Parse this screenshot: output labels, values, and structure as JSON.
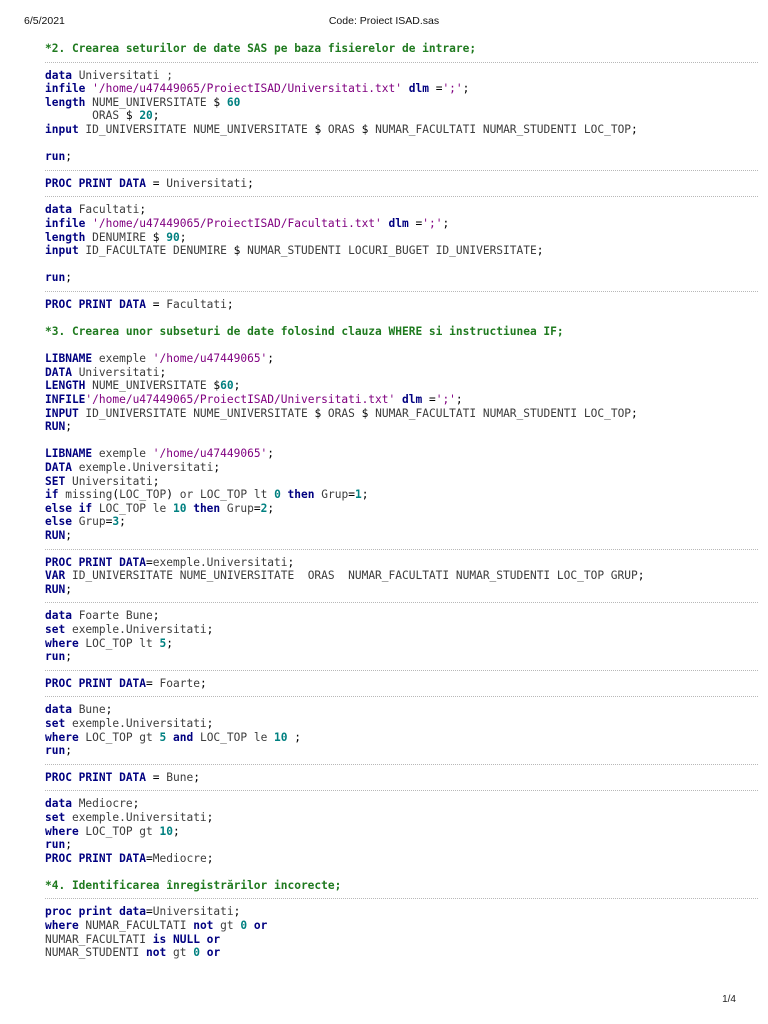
{
  "header": {
    "date": "6/5/2021",
    "title": "Code: Proiect ISAD.sas"
  },
  "footer": {
    "page": "1/4"
  },
  "code": [
    [
      [
        "cm",
        "*2. Crearea seturilor de date SAS pe baza fisierelor de intrare;"
      ]
    ],
    "sep",
    [
      [
        "kw",
        "data "
      ],
      [
        "tx",
        "Universitati ;"
      ]
    ],
    [
      [
        "kw",
        "infile "
      ],
      [
        "st",
        "'/home/u47449065/ProiectISAD/Universitati.txt'"
      ],
      [
        "kw",
        " dlm "
      ],
      [
        "pn",
        "="
      ],
      [
        "st",
        "';'"
      ],
      [
        "pn",
        ";"
      ]
    ],
    [
      [
        "kw",
        "length "
      ],
      [
        "tx",
        "NUME_UNIVERSITATE "
      ],
      [
        "pn",
        "$ "
      ],
      [
        "nm",
        "60"
      ]
    ],
    [
      [
        "tx",
        "       ORAS "
      ],
      [
        "pn",
        "$ "
      ],
      [
        "nm",
        "20"
      ],
      [
        "pn",
        ";"
      ]
    ],
    [
      [
        "kw",
        "input "
      ],
      [
        "tx",
        "ID_UNIVERSITATE NUME_UNIVERSITATE "
      ],
      [
        "pn",
        "$ "
      ],
      [
        "tx",
        "ORAS "
      ],
      [
        "pn",
        "$ "
      ],
      [
        "tx",
        "NUMAR_FACULTATI NUMAR_STUDENTI LOC_TOP"
      ],
      [
        "pn",
        ";"
      ]
    ],
    "gap",
    [
      [
        "kw",
        "run"
      ],
      [
        "pn",
        ";"
      ]
    ],
    "sep",
    [
      [
        "kw",
        "PROC PRINT DATA "
      ],
      [
        "pn",
        "= "
      ],
      [
        "tx",
        "Universitati"
      ],
      [
        "pn",
        ";"
      ]
    ],
    "sep",
    [
      [
        "kw",
        "data "
      ],
      [
        "tx",
        "Facultati"
      ],
      [
        "pn",
        ";"
      ]
    ],
    [
      [
        "kw",
        "infile "
      ],
      [
        "st",
        "'/home/u47449065/ProiectISAD/Facultati.txt'"
      ],
      [
        "kw",
        " dlm "
      ],
      [
        "pn",
        "="
      ],
      [
        "st",
        "';'"
      ],
      [
        "pn",
        ";"
      ]
    ],
    [
      [
        "kw",
        "length "
      ],
      [
        "tx",
        "DENUMIRE "
      ],
      [
        "pn",
        "$ "
      ],
      [
        "nm",
        "90"
      ],
      [
        "pn",
        ";"
      ]
    ],
    [
      [
        "kw",
        "input "
      ],
      [
        "tx",
        "ID_FACULTATE DENUMIRE "
      ],
      [
        "pn",
        "$ "
      ],
      [
        "tx",
        "NUMAR_STUDENTI LOCURI_BUGET ID_UNIVERSITATE"
      ],
      [
        "pn",
        ";"
      ]
    ],
    "gap",
    [
      [
        "kw",
        "run"
      ],
      [
        "pn",
        ";"
      ]
    ],
    "sep",
    [
      [
        "kw",
        "PROC PRINT DATA "
      ],
      [
        "pn",
        "= "
      ],
      [
        "tx",
        "Facultati"
      ],
      [
        "pn",
        ";"
      ]
    ],
    "gap",
    [
      [
        "cm",
        "*3. Crearea unor subseturi de date folosind clauza WHERE si instructiunea IF;"
      ]
    ],
    "gap",
    [
      [
        "kw",
        "LIBNAME "
      ],
      [
        "tx",
        "exemple "
      ],
      [
        "st",
        "'/home/u47449065'"
      ],
      [
        "pn",
        ";"
      ]
    ],
    [
      [
        "kw",
        "DATA "
      ],
      [
        "tx",
        "Universitati"
      ],
      [
        "pn",
        ";"
      ]
    ],
    [
      [
        "kw",
        "LENGTH "
      ],
      [
        "tx",
        "NUME_UNIVERSITATE "
      ],
      [
        "pn",
        "$"
      ],
      [
        "nm",
        "60"
      ],
      [
        "pn",
        ";"
      ]
    ],
    [
      [
        "kw",
        "INFILE"
      ],
      [
        "st",
        "'/home/u47449065/ProiectISAD/Universitati.txt'"
      ],
      [
        "kw",
        " dlm "
      ],
      [
        "pn",
        "="
      ],
      [
        "st",
        "';'"
      ],
      [
        "pn",
        ";"
      ]
    ],
    [
      [
        "kw",
        "INPUT "
      ],
      [
        "tx",
        "ID_UNIVERSITATE NUME_UNIVERSITATE "
      ],
      [
        "pn",
        "$ "
      ],
      [
        "tx",
        "ORAS "
      ],
      [
        "pn",
        "$ "
      ],
      [
        "tx",
        "NUMAR_FACULTATI NUMAR_STUDENTI LOC_TOP"
      ],
      [
        "pn",
        ";"
      ]
    ],
    [
      [
        "kw",
        "RUN"
      ],
      [
        "pn",
        ";"
      ]
    ],
    "gap",
    [
      [
        "kw",
        "LIBNAME "
      ],
      [
        "tx",
        "exemple "
      ],
      [
        "st",
        "'/home/u47449065'"
      ],
      [
        "pn",
        ";"
      ]
    ],
    [
      [
        "kw",
        "DATA "
      ],
      [
        "tx",
        "exemple.Universitati"
      ],
      [
        "pn",
        ";"
      ]
    ],
    [
      [
        "kw",
        "SET "
      ],
      [
        "tx",
        "Universitati"
      ],
      [
        "pn",
        ";"
      ]
    ],
    [
      [
        "kw",
        "if "
      ],
      [
        "tx",
        "missing"
      ],
      [
        "pn",
        "("
      ],
      [
        "tx",
        "LOC_TOP"
      ],
      [
        "pn",
        ") "
      ],
      [
        "tx",
        "or LOC_TOP lt "
      ],
      [
        "nm",
        "0"
      ],
      [
        "kw",
        " then "
      ],
      [
        "tx",
        "Grup"
      ],
      [
        "pn",
        "="
      ],
      [
        "nm",
        "1"
      ],
      [
        "pn",
        ";"
      ]
    ],
    [
      [
        "kw",
        "else if "
      ],
      [
        "tx",
        "LOC_TOP le "
      ],
      [
        "nm",
        "10"
      ],
      [
        "kw",
        " then "
      ],
      [
        "tx",
        "Grup"
      ],
      [
        "pn",
        "="
      ],
      [
        "nm",
        "2"
      ],
      [
        "pn",
        ";"
      ]
    ],
    [
      [
        "kw",
        "else "
      ],
      [
        "tx",
        "Grup"
      ],
      [
        "pn",
        "="
      ],
      [
        "nm",
        "3"
      ],
      [
        "pn",
        ";"
      ]
    ],
    [
      [
        "kw",
        "RUN"
      ],
      [
        "pn",
        ";"
      ]
    ],
    "sep",
    [
      [
        "kw",
        "PROC PRINT DATA"
      ],
      [
        "pn",
        "="
      ],
      [
        "tx",
        "exemple.Universitati"
      ],
      [
        "pn",
        ";"
      ]
    ],
    [
      [
        "kw",
        "VAR "
      ],
      [
        "tx",
        "ID_UNIVERSITATE NUME_UNIVERSITATE  ORAS  NUMAR_FACULTATI NUMAR_STUDENTI LOC_TOP GRUP"
      ],
      [
        "pn",
        ";"
      ]
    ],
    [
      [
        "kw",
        "RUN"
      ],
      [
        "pn",
        ";"
      ]
    ],
    "sep",
    [
      [
        "kw",
        "data "
      ],
      [
        "tx",
        "Foarte Bune"
      ],
      [
        "pn",
        ";"
      ]
    ],
    [
      [
        "kw",
        "set "
      ],
      [
        "tx",
        "exemple.Universitati"
      ],
      [
        "pn",
        ";"
      ]
    ],
    [
      [
        "kw",
        "where "
      ],
      [
        "tx",
        "LOC_TOP lt "
      ],
      [
        "nm",
        "5"
      ],
      [
        "pn",
        ";"
      ]
    ],
    [
      [
        "kw",
        "run"
      ],
      [
        "pn",
        ";"
      ]
    ],
    "sep",
    [
      [
        "kw",
        "PROC PRINT DATA"
      ],
      [
        "pn",
        "= "
      ],
      [
        "tx",
        "Foarte"
      ],
      [
        "pn",
        ";"
      ]
    ],
    "sep",
    [
      [
        "kw",
        "data "
      ],
      [
        "tx",
        "Bune"
      ],
      [
        "pn",
        ";"
      ]
    ],
    [
      [
        "kw",
        "set "
      ],
      [
        "tx",
        "exemple.Universitati"
      ],
      [
        "pn",
        ";"
      ]
    ],
    [
      [
        "kw",
        "where "
      ],
      [
        "tx",
        "LOC_TOP gt "
      ],
      [
        "nm",
        "5"
      ],
      [
        "kw",
        " and "
      ],
      [
        "tx",
        "LOC_TOP le "
      ],
      [
        "nm",
        "10"
      ],
      [
        "pn",
        " ;"
      ]
    ],
    [
      [
        "kw",
        "run"
      ],
      [
        "pn",
        ";"
      ]
    ],
    "sep",
    [
      [
        "kw",
        "PROC PRINT DATA "
      ],
      [
        "pn",
        "= "
      ],
      [
        "tx",
        "Bune"
      ],
      [
        "pn",
        ";"
      ]
    ],
    "sep",
    [
      [
        "kw",
        "data "
      ],
      [
        "tx",
        "Mediocre"
      ],
      [
        "pn",
        ";"
      ]
    ],
    [
      [
        "kw",
        "set "
      ],
      [
        "tx",
        "exemple.Universitati"
      ],
      [
        "pn",
        ";"
      ]
    ],
    [
      [
        "kw",
        "where "
      ],
      [
        "tx",
        "LOC_TOP gt "
      ],
      [
        "nm",
        "10"
      ],
      [
        "pn",
        ";"
      ]
    ],
    [
      [
        "kw",
        "run"
      ],
      [
        "pn",
        ";"
      ]
    ],
    [
      [
        "kw",
        "PROC PRINT DATA"
      ],
      [
        "pn",
        "="
      ],
      [
        "tx",
        "Mediocre"
      ],
      [
        "pn",
        ";"
      ]
    ],
    "gap",
    [
      [
        "cm",
        "*4. Identificarea înregistrărilor incorecte;"
      ]
    ],
    "sep",
    [
      [
        "kw",
        "proc print data"
      ],
      [
        "pn",
        "="
      ],
      [
        "tx",
        "Universitati"
      ],
      [
        "pn",
        ";"
      ]
    ],
    [
      [
        "kw",
        "where "
      ],
      [
        "tx",
        "NUMAR_FACULTATI "
      ],
      [
        "kw",
        "not "
      ],
      [
        "tx",
        "gt "
      ],
      [
        "nm",
        "0"
      ],
      [
        "kw",
        " or"
      ]
    ],
    [
      [
        "tx",
        "NUMAR_FACULTATI "
      ],
      [
        "kw",
        "is NULL or"
      ]
    ],
    [
      [
        "tx",
        "NUMAR_STUDENTI "
      ],
      [
        "kw",
        "not "
      ],
      [
        "tx",
        "gt "
      ],
      [
        "nm",
        "0"
      ],
      [
        "kw",
        " or"
      ]
    ]
  ]
}
